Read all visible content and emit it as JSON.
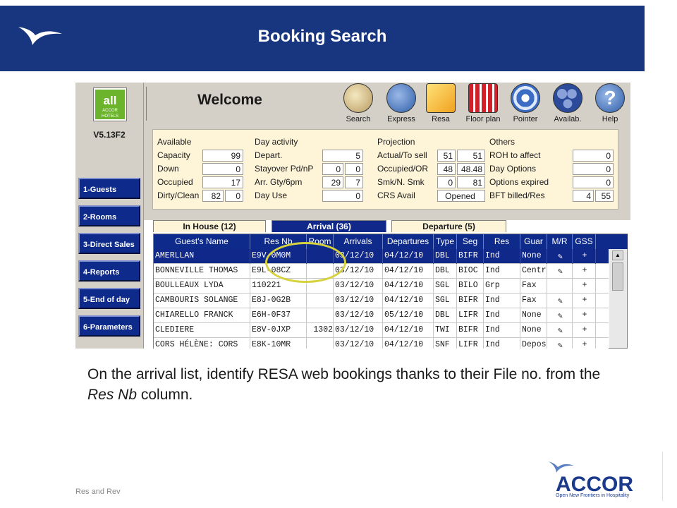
{
  "slide": {
    "title": "Booking Search",
    "caption": "On the arrival list, identify RESA web bookings thanks to their File no. from the Res Nb column.",
    "footer": "Res and Rev"
  },
  "accor": {
    "brand": "ACCOR",
    "tagline": "Open New Frontiers in Hospitality"
  },
  "app": {
    "logo_text": "all",
    "logo_subtext": "ACCOR HOTELS",
    "version": "V5.13F2",
    "welcome": "Welcome",
    "nav": [
      "1-Guests",
      "2-Rooms",
      "3-Direct Sales",
      "4-Reports",
      "5-End of day",
      "6-Parameters"
    ],
    "toolbar": [
      "Search",
      "Express",
      "Resa",
      "Floor plan",
      "Pointer",
      "Availab.",
      "Help"
    ],
    "available": {
      "title": "Available",
      "rows": [
        {
          "label": "Capacity",
          "v1": "",
          "v2": "99"
        },
        {
          "label": "Down",
          "v1": "",
          "v2": "0"
        },
        {
          "label": "Occupied",
          "v1": "",
          "v2": "17"
        },
        {
          "label": "Dirty/Clean",
          "v1": "82",
          "v2": "0"
        }
      ]
    },
    "day_activity": {
      "title": "Day activity",
      "rows": [
        {
          "label": "Depart.",
          "v1": "",
          "v2": "5"
        },
        {
          "label": "Stayover Pd/nP",
          "v1": "0",
          "v2": "0"
        },
        {
          "label": "Arr. Gty/6pm",
          "v1": "29",
          "v2": "7"
        },
        {
          "label": "Day Use",
          "v1": "",
          "v2": "0"
        }
      ]
    },
    "projection": {
      "title": "Projection",
      "rows": [
        {
          "label": "Actual/To sell",
          "v1": "51",
          "v2": "51"
        },
        {
          "label": "Occupied/OR",
          "v1": "48",
          "v2": "48.48"
        },
        {
          "label": "Smk/N. Smk",
          "v1": "0",
          "v2": "81"
        },
        {
          "label": "CRS Avail",
          "v1": "",
          "v2": "Opened"
        }
      ]
    },
    "others": {
      "title": "Others",
      "rows": [
        {
          "label": "ROH to affect",
          "v1": "",
          "v2": "0"
        },
        {
          "label": "Day Options",
          "v1": "",
          "v2": "0"
        },
        {
          "label": "Options expired",
          "v1": "",
          "v2": "0"
        },
        {
          "label": "BFT billed/Res",
          "v1": "4",
          "v2": "55"
        }
      ]
    },
    "tabs": {
      "in_house": "In House (12)",
      "arrival": "Arrival (36)",
      "departure": "Departure (5)"
    },
    "columns": [
      "Guest's Name",
      "Res Nb",
      "Room",
      "Arrivals",
      "Departures",
      "Type",
      "Seg",
      "Res",
      "Guar",
      "M/R",
      "GSS"
    ],
    "rows": [
      [
        "AMERLLAN",
        "E9V-0M0M",
        "",
        "03/12/10",
        "04/12/10",
        "DBL",
        "BIFR",
        "Ind",
        "None",
        "✎",
        "+"
      ],
      [
        "BONNEVILLE THOMAS",
        "E9L-08CZ",
        "",
        "03/12/10",
        "04/12/10",
        "DBL",
        "BIOC",
        "Ind",
        "Centr",
        "✎",
        "+"
      ],
      [
        "BOULLEAUX LYDA",
        "110221",
        "",
        "03/12/10",
        "04/12/10",
        "SGL",
        "BILO",
        "Grp",
        "Fax",
        "",
        "+"
      ],
      [
        "CAMBOURIS SOLANGE",
        "E8J-0G2B",
        "",
        "03/12/10",
        "04/12/10",
        "SGL",
        "BIFR",
        "Ind",
        "Fax",
        "✎",
        "+"
      ],
      [
        "CHIARELLO FRANCK",
        "E6H-0F37",
        "",
        "03/12/10",
        "05/12/10",
        "DBL",
        "LIFR",
        "Ind",
        "None",
        "✎",
        "+"
      ],
      [
        "CLEDIERE",
        "E8V-0JXP",
        "1302",
        "03/12/10",
        "04/12/10",
        "TWI",
        "BIFR",
        "Ind",
        "None",
        "✎",
        "+"
      ],
      [
        "CORS HÉLÈNE: CORS",
        "E8K-10MR",
        "",
        "03/12/10",
        "04/12/10",
        "SNF",
        "LIFR",
        "Ind",
        "Depos",
        "✎",
        "+"
      ]
    ]
  }
}
